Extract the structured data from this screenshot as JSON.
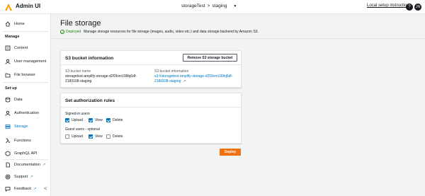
{
  "app": {
    "title": "Admin UI"
  },
  "topbar": {
    "breadcrumb_app": "storageTest",
    "breadcrumb_sep": ">",
    "breadcrumb_env": "staging",
    "dropdown_glyph": "▼",
    "local_setup": "Local setup instructions",
    "help_glyph": "?",
    "avatar_initials": "JN"
  },
  "sidebar": {
    "home": "Home",
    "manage_heading": "Manage",
    "content": "Content",
    "user_management": "User management",
    "file_browser": "File browser",
    "setup_heading": "Set up",
    "data": "Data",
    "authentication": "Authentication",
    "storage": "Storage",
    "functions": "Functions",
    "graphql_api": "GraphQL API",
    "documentation": "Documentation",
    "support": "Support",
    "feedback": "Feedback",
    "collapse_glyph": "<"
  },
  "page": {
    "title": "File storage",
    "status": "Deployed",
    "description": "Manage storage resources for file storage (images, audio, video etc.) and data storage backend by Amazon S3."
  },
  "bucket_panel": {
    "title": "S3 bucket information",
    "remove_button": "Remove S3 storage bucket",
    "name_label": "S3 bucket name",
    "name_line1": "storagetest-amplify-storage-d259vm199bj6df-",
    "name_line2": "2180108-staging",
    "info_label": "S3 bucket information",
    "info_line1": "s3://storagetest-amplify-storage-d259vm199bj6df-",
    "info_line2": "2180108-staging",
    "ext_glyph": "↗"
  },
  "auth_panel": {
    "title": "Set authorization rules",
    "signed_in_label": "Signed-in users",
    "guest_label": "Guest users - optional",
    "upload": "Upload",
    "view": "View",
    "delete": "Delete",
    "signed_in": {
      "upload": true,
      "view": true,
      "delete": true
    },
    "guest": {
      "upload": false,
      "view": true,
      "delete": false
    }
  },
  "actions": {
    "deploy": "Deploy"
  },
  "colors": {
    "accent": "#0073bb",
    "deploy": "#ec7211",
    "success": "#1d8102"
  },
  "icons": [
    "amplify-logo-icon",
    "home-icon",
    "content-icon",
    "users-icon",
    "folder-icon",
    "data-icon",
    "auth-icon",
    "storage-icon",
    "lambda-icon",
    "graphql-icon",
    "doc-icon",
    "support-icon",
    "feedback-icon",
    "external-link-icon",
    "check-circle-icon",
    "help-icon",
    "chevron-left-icon"
  ]
}
